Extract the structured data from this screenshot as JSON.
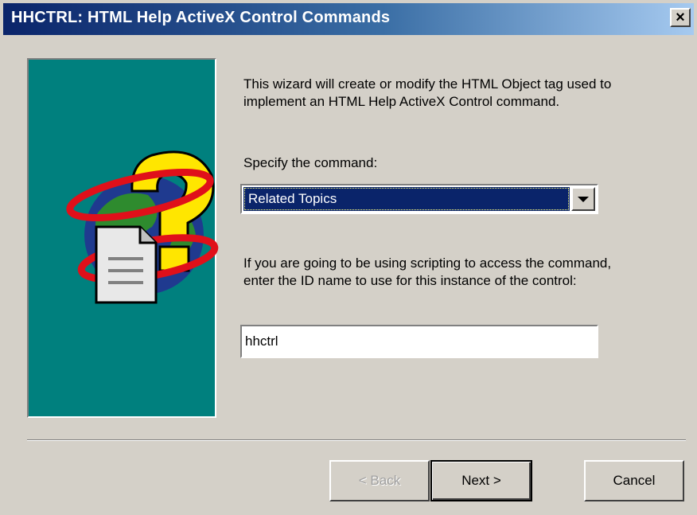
{
  "window": {
    "title": "HHCTRL:  HTML Help ActiveX Control Commands",
    "close_glyph": "×"
  },
  "wizard": {
    "intro": "This wizard will create or modify the HTML Object tag used to implement an HTML Help ActiveX Control command.",
    "command_label": "Specify the command:",
    "command_value": "Related Topics",
    "scripting_prompt": "If you are going to be using scripting to access the command, enter the ID name to use for this instance of the control:",
    "id_value": "hhctrl"
  },
  "buttons": {
    "back": "< Back",
    "next": "Next >",
    "cancel": "Cancel"
  },
  "icons": {
    "side_art": "help-globe-question-icon",
    "dropdown": "chevron-down-icon"
  },
  "colors": {
    "title_start": "#0a246a",
    "title_end": "#a6caf0",
    "panel": "#00807e",
    "selection": "#0a246a",
    "dialog": "#d4d0c8"
  }
}
